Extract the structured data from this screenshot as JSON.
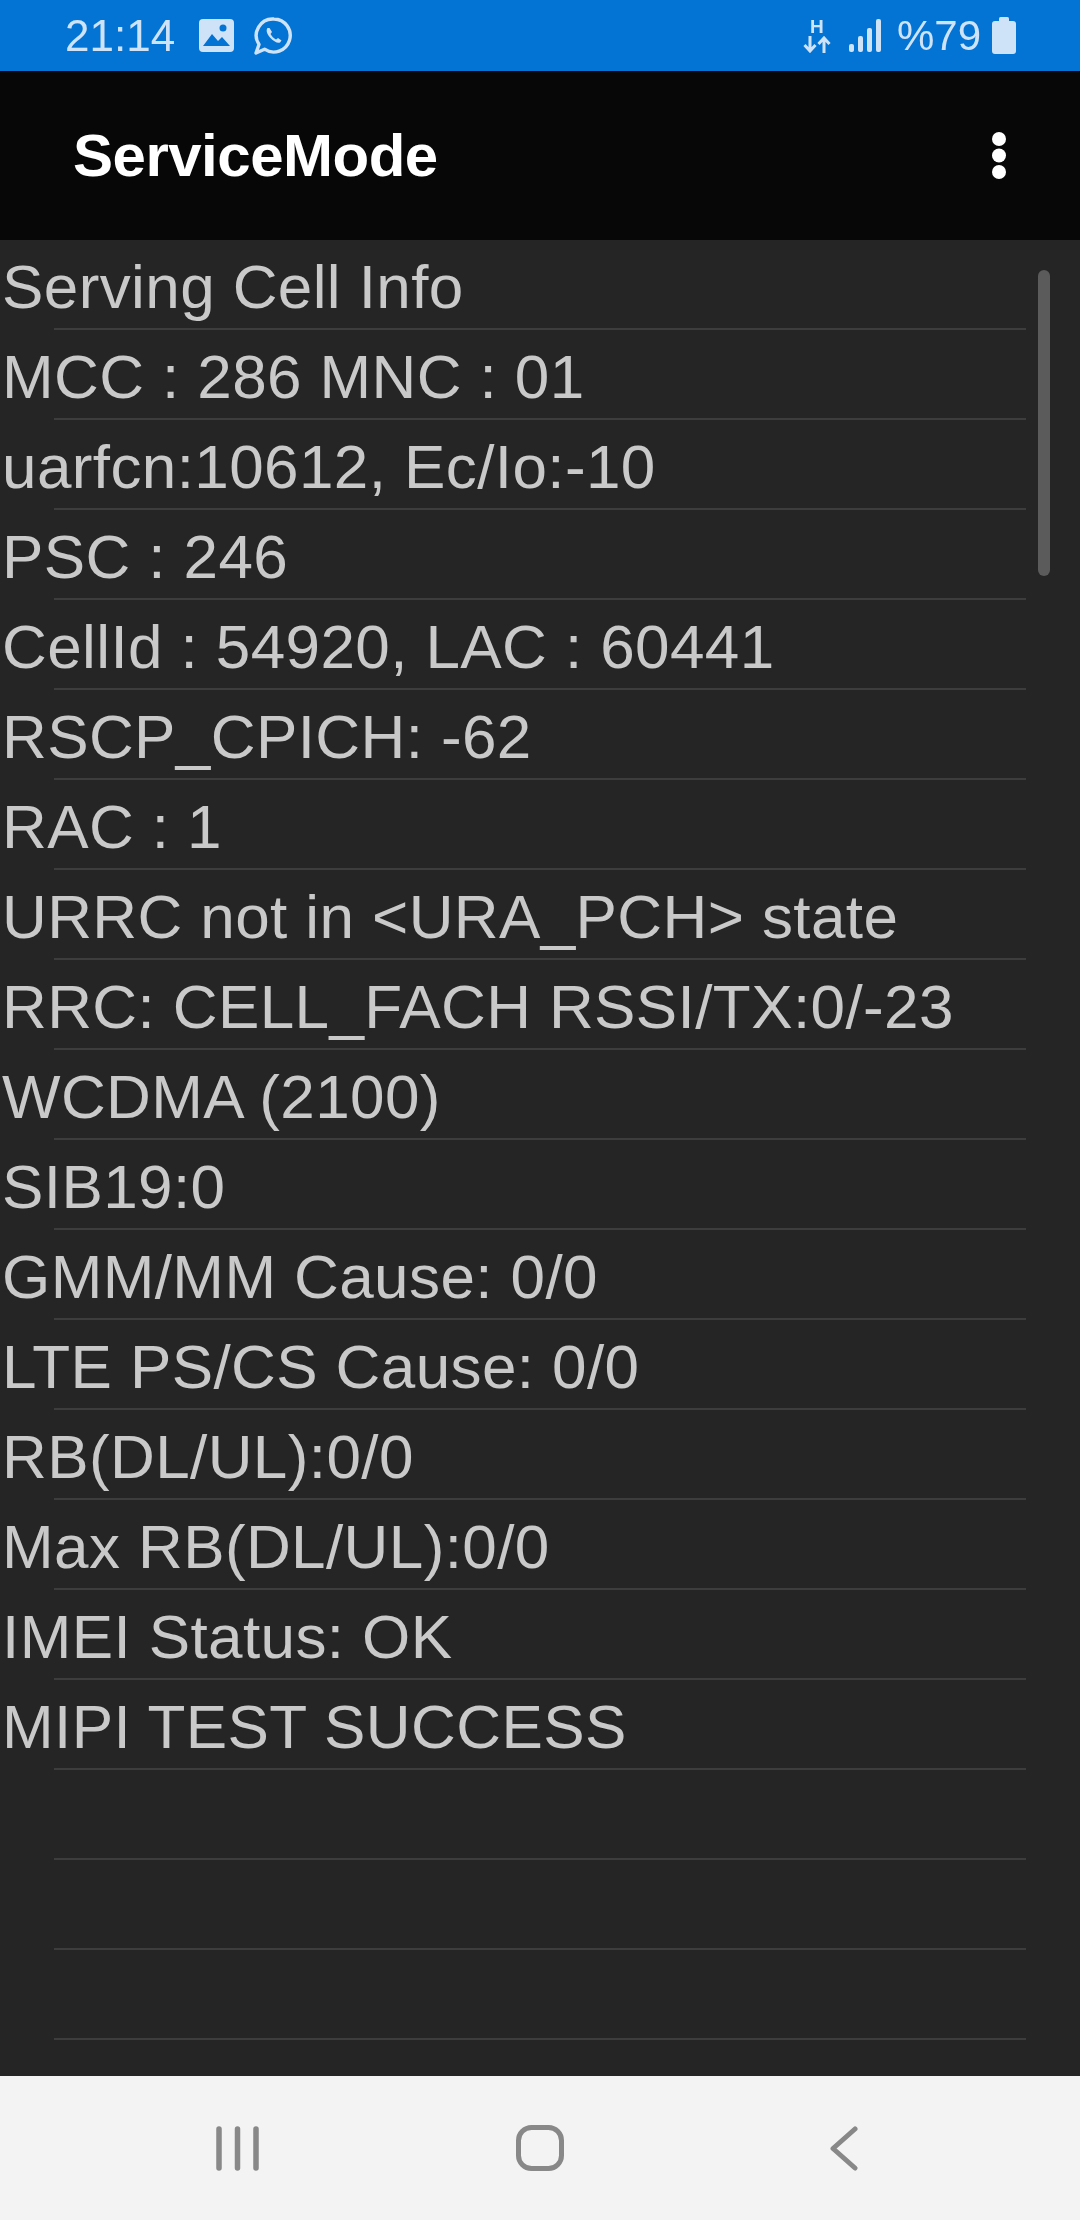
{
  "status_bar": {
    "time": "21:14",
    "network_type": "H",
    "battery_text": "%79"
  },
  "app_bar": {
    "title": "ServiceMode"
  },
  "info_lines": [
    "Serving Cell Info",
    "MCC : 286 MNC : 01",
    "uarfcn:10612, Ec/Io:-10",
    "PSC : 246",
    "CellId : 54920, LAC : 60441",
    "RSCP_CPICH: -62",
    "RAC : 1",
    "URRC not in <URA_PCH> state",
    "RRC: CELL_FACH RSSI/TX:0/-23",
    "WCDMA (2100)",
    "SIB19:0",
    "GMM/MM Cause: 0/0",
    "LTE PS/CS Cause: 0/0",
    "RB(DL/UL):0/0",
    "Max RB(DL/UL):0/0",
    "IMEI Status: OK",
    "MIPI TEST SUCCESS"
  ]
}
